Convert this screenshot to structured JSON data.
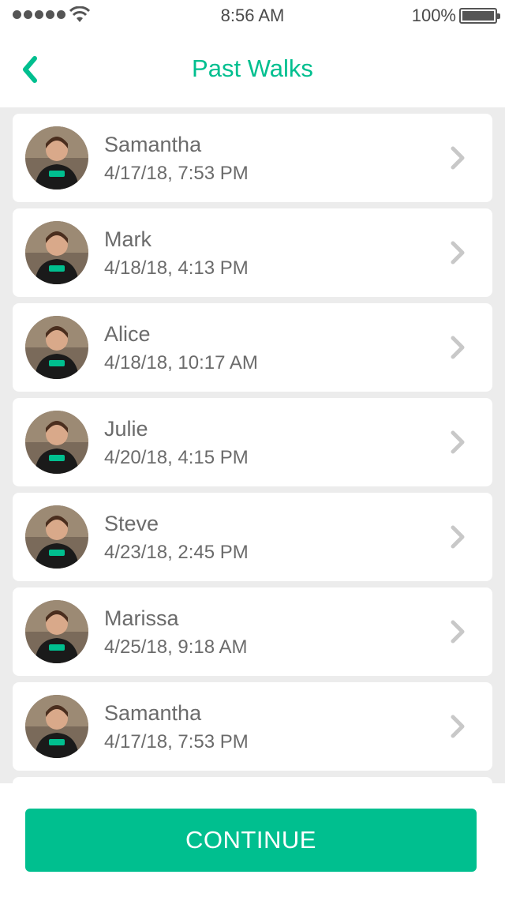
{
  "status_bar": {
    "time": "8:56 AM",
    "battery": "100%",
    "icons": [
      "signal-dots-icon",
      "wifi-icon",
      "battery-icon"
    ]
  },
  "nav": {
    "title": "Past Walks",
    "back_icon": "chevron-left-icon"
  },
  "colors": {
    "accent": "#00bf8f",
    "background": "#ececec",
    "text": "#6b6b6b"
  },
  "walks": [
    {
      "name": "Samantha",
      "date": "4/17/18, 7:53 PM"
    },
    {
      "name": "Mark",
      "date": "4/18/18, 4:13 PM"
    },
    {
      "name": "Alice",
      "date": "4/18/18, 10:17 AM"
    },
    {
      "name": "Julie",
      "date": "4/20/18, 4:15 PM"
    },
    {
      "name": "Steve",
      "date": "4/23/18, 2:45 PM"
    },
    {
      "name": "Marissa",
      "date": "4/25/18, 9:18 AM"
    },
    {
      "name": "Samantha",
      "date": "4/17/18, 7:53 PM"
    }
  ],
  "footer": {
    "continue_label": "CONTINUE"
  }
}
